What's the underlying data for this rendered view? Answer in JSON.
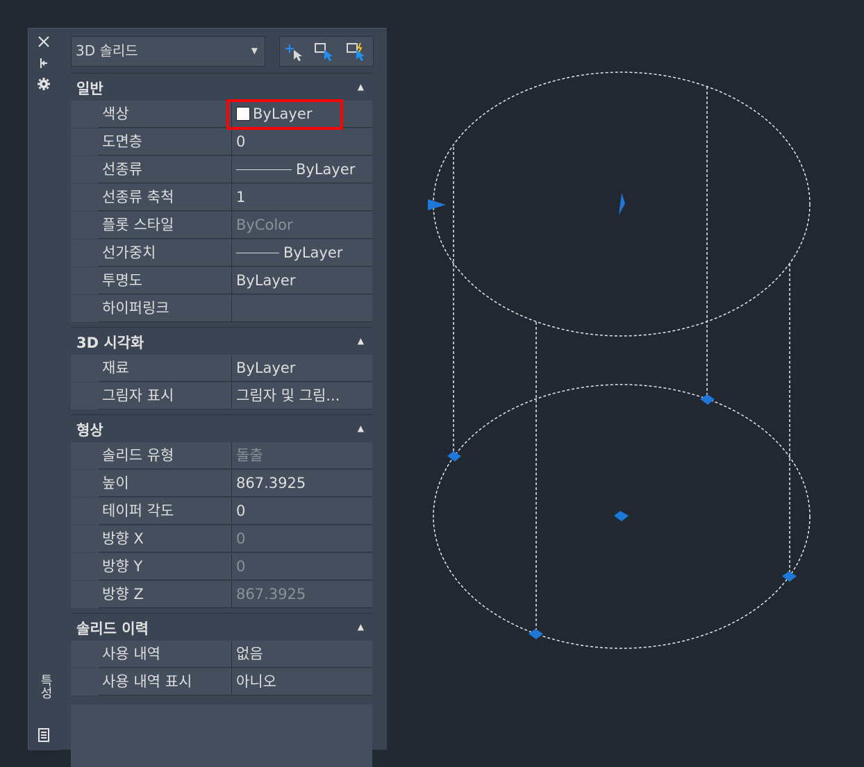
{
  "object_selector": {
    "value": "3D 솔리드"
  },
  "side_toolbar": {
    "close_icon": "close-icon",
    "autohide_icon": "pin-icon",
    "settings_icon": "gear-icon",
    "palette_title": "특성"
  },
  "tool_buttons": [
    "quick-select-icon",
    "select-objects-icon",
    "toggle-pickadd-icon"
  ],
  "sections": {
    "general": {
      "title": "일반",
      "rows": [
        {
          "name": "색상",
          "value": "ByLayer"
        },
        {
          "name": "도면층",
          "value": "0"
        },
        {
          "name": "선종류",
          "value": "ByLayer"
        },
        {
          "name": "선종류 축척",
          "value": "1"
        },
        {
          "name": "플롯 스타일",
          "value": "ByColor"
        },
        {
          "name": "선가중치",
          "value": "ByLayer"
        },
        {
          "name": "투명도",
          "value": "ByLayer"
        },
        {
          "name": "하이퍼링크",
          "value": ""
        }
      ]
    },
    "visualization": {
      "title": "3D 시각화",
      "rows": [
        {
          "name": "재료",
          "value": "ByLayer"
        },
        {
          "name": "그림자 표시",
          "value": "그림자 및 그림..."
        }
      ]
    },
    "geometry": {
      "title": "형상",
      "rows": [
        {
          "name": "솔리드 유형",
          "value": "돌출"
        },
        {
          "name": "높이",
          "value": "867.3925"
        },
        {
          "name": "테이퍼 각도",
          "value": "0"
        },
        {
          "name": "방향 X",
          "value": "0"
        },
        {
          "name": "방향 Y",
          "value": "0"
        },
        {
          "name": "방향 Z",
          "value": "867.3925"
        }
      ]
    },
    "history": {
      "title": "솔리드 이력",
      "rows": [
        {
          "name": "사용 내역",
          "value": "없음"
        },
        {
          "name": "사용 내역 표시",
          "value": "아니오"
        }
      ]
    }
  },
  "colors": {
    "background": "#222831",
    "panel": "#3b4453",
    "cell": "#454e5d",
    "grip": "#1e78d8",
    "highlight": "#ff0000"
  }
}
